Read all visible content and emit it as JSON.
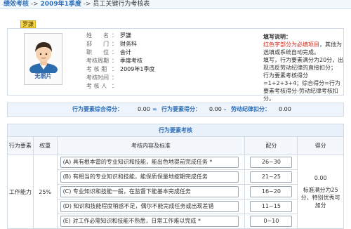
{
  "breadcrumb": {
    "section": "绩效考核",
    "sep1": " -> ",
    "period": "2009年1季度",
    "sep2": " -> ",
    "current": "员工关键行为考核表"
  },
  "employee_tab": "罗謙",
  "photo": {
    "label": "无照片"
  },
  "fields": [
    {
      "label": "姓　　名",
      "value": "罗謙"
    },
    {
      "label": "部　　门",
      "value": "财务科"
    },
    {
      "label": "职　　位",
      "value": "会计"
    },
    {
      "label": "考核周期",
      "value": "季度考核"
    },
    {
      "label": "考 核 期",
      "value": "2009年1季度"
    },
    {
      "label": "考核时间",
      "value": ""
    },
    {
      "label": "考 核 人",
      "value": ""
    }
  ],
  "notes": {
    "title": "填写说明：",
    "line1_red": "红色字部分为必填项目",
    "line1_rest": "，其他为选填或系统自动完成。",
    "line2": "填写，行为要素满分为20分，出现违反劳动纪律的直接扣分；",
    "line3": "行为要素考核得分=1+2+3+4；综合得分=行为要素考核得分-劳动纪律考核扣分。"
  },
  "totals": {
    "overall_label": "行为要素综合得分：",
    "overall_value": "0.00",
    "eq": " = ",
    "element_label": "行为要素得分：",
    "element_value": "0.00",
    "minus": " - ",
    "deduct_label": "劳动纪律扣分：",
    "deduct_value": "0.00"
  },
  "section_title": "行为要素考核",
  "table": {
    "headers": {
      "category": "行为要素",
      "weight": "权重",
      "content": "考核内容及标准",
      "points": "配分",
      "score": "得分"
    },
    "category": "工作能力",
    "weight": "25%",
    "rows": [
      {
        "text": "(A) 具有根本雷的专业知识和技能，能出色地提前完成任务 *",
        "range": "26~30"
      },
      {
        "text": "(B) 有相当的专业知识和技能，能保质保量地按期完成任务",
        "range": "21~25"
      },
      {
        "text": "(C) 专业知识和技能一般，在监督下能基本完成任务",
        "range": "16~20"
      },
      {
        "text": "(D) 知识和技能程度稍感不足，偶尔不能完成任务或出现差错",
        "range": "11~15"
      },
      {
        "text": "(E) 对工作必需知识和技能不熟悉，日常工作难以完成 *",
        "range": "0~10"
      }
    ],
    "score_value": "0.00",
    "score_note": "标准满分为25分，特别优秀可加分"
  }
}
